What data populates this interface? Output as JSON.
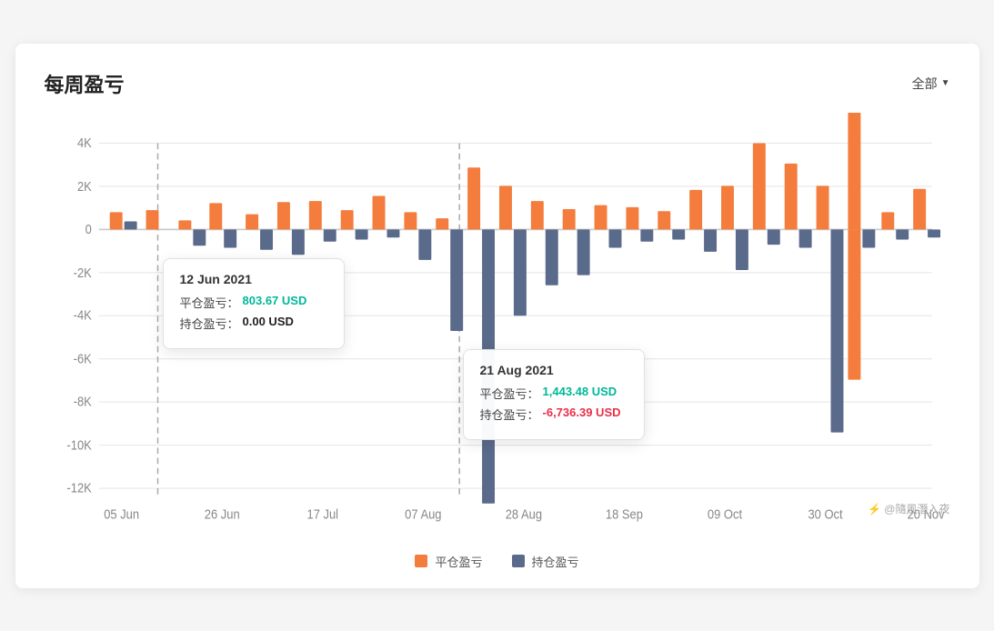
{
  "header": {
    "title": "每周盈亏",
    "filter_label": "全部",
    "filter_arrow": "▼"
  },
  "legend": [
    {
      "id": "closed",
      "label": "平仓盈亏",
      "color": "#f47c3c"
    },
    {
      "id": "open",
      "label": "持仓盈亏",
      "color": "#5a6a8a"
    }
  ],
  "tooltip1": {
    "date": "12 Jun 2021",
    "row1_label": "平仓盈亏：",
    "row1_value": "803.67 USD",
    "row1_color": "green",
    "row2_label": "持仓盈亏：",
    "row2_value": "0.00 USD",
    "row2_color": "black"
  },
  "tooltip2": {
    "date": "21 Aug 2021",
    "row1_label": "平仓盈亏：",
    "row1_value": "1,443.48 USD",
    "row1_color": "green",
    "row2_label": "持仓盈亏：",
    "row2_value": "-6,736.39 USD",
    "row2_color": "red"
  },
  "x_labels": [
    "05 Jun",
    "26 Jun",
    "17 Jul",
    "07 Aug",
    "28 Aug",
    "18 Sep",
    "09 Oct",
    "30 Oct",
    "20 Nov"
  ],
  "y_labels": [
    "4K",
    "2K",
    "0",
    "‑2K",
    "‑4K",
    "‑6K",
    "‑8K",
    "‑10K",
    "‑12K"
  ],
  "watermark": "隨風潛入夜"
}
